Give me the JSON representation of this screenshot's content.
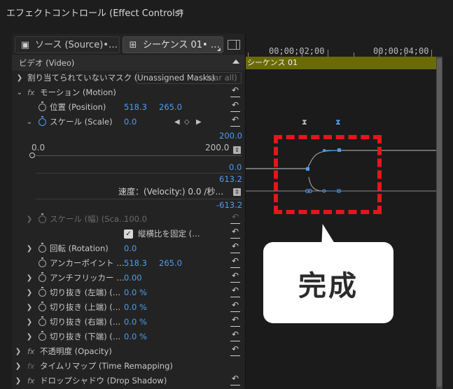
{
  "panel": {
    "title": "エフェクトコントロール (Effect Controls)",
    "menu_icon": "≡"
  },
  "tabs": [
    {
      "label": "ソース (Source)•…",
      "icon": "source-icon"
    },
    {
      "label": "シーケンス 01• …",
      "icon": "sequence-icon"
    }
  ],
  "sections": {
    "video": "ビデオ (Video)",
    "mask": "割り当てられていないマスク (Unassigned Masks)",
    "mask_clear": "lear all)",
    "motion": "モーション (Motion)",
    "fx": "fx"
  },
  "position": {
    "label": "位置 (Position)",
    "x": "518.3",
    "y": "265.0"
  },
  "scale": {
    "label": "スケール (Scale)",
    "value": "0.0"
  },
  "scale_graph": {
    "top_value": "200.0",
    "slider_min": "0.0",
    "slider_max": "200.0",
    "mid_value": "0.0",
    "vel_top": "613.2",
    "velocity_label": "速度：(Velocity:) 0.0 /秒…",
    "vel_bottom": "-613.2"
  },
  "scale_width": {
    "label": "スケール (幅) (Sca…",
    "value": "100.0"
  },
  "uniform": {
    "label": "縦横比を固定 (…",
    "check": "✓"
  },
  "rotation": {
    "label": "回転 (Rotation)",
    "value": "0.0"
  },
  "anchor": {
    "label": "アンカーポイント …",
    "x": "518.3",
    "y": "265.0"
  },
  "antiflicker": {
    "label": "アンチフリッカー …",
    "value": "0.00"
  },
  "crops": [
    {
      "label": "切り抜き (左端) (…",
      "value": "0.0 %"
    },
    {
      "label": "切り抜き (上端) (…",
      "value": "0.0 %"
    },
    {
      "label": "切り抜き (右端) (…",
      "value": "0.0 %"
    },
    {
      "label": "切り抜き (下端) (…",
      "value": "0.0 %"
    }
  ],
  "opacity": {
    "label": "不透明度 (Opacity)"
  },
  "time_remap": {
    "label": "タイムリマップ (Time Remapping)"
  },
  "drop_shadow": {
    "label": "ドロップシャドウ (Drop Shadow)"
  },
  "timeline": {
    "tc1": "00;00;02;00",
    "tc2": "00;00;04;00",
    "clip": "シーケンス 01"
  },
  "callout": {
    "text": "完成"
  },
  "colors": {
    "accent": "#4b9ff2",
    "clip": "#6b6b06",
    "annotation": "#e8141b"
  }
}
